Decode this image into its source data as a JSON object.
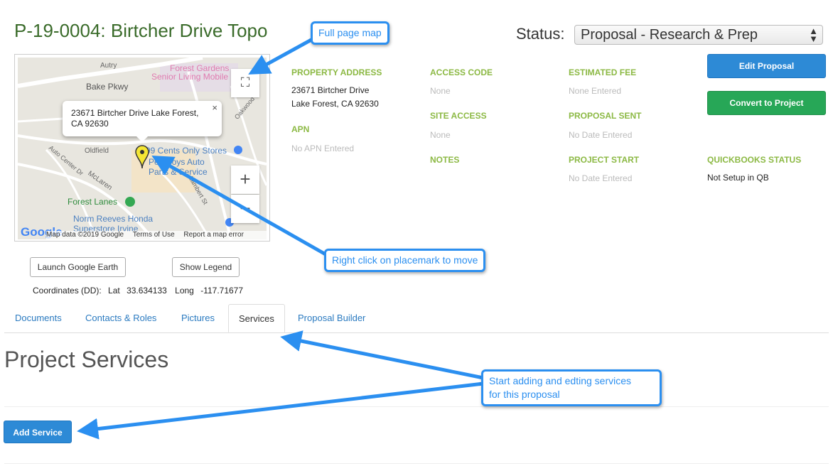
{
  "page": {
    "title": "P-19-0004: Birtcher Drive Topo",
    "status_label": "Status:",
    "status_value": "Proposal - Research & Prep"
  },
  "map": {
    "popup_line1": "23671 Birtcher Drive Lake Forest,",
    "popup_line2": "CA 92630",
    "close_glyph": "×",
    "zoom_in": "+",
    "zoom_out": "−",
    "labels": {
      "autry": "Autry",
      "bake_pkwy": "Bake Pkwy",
      "forest_gardens_1": "Forest Gardens",
      "forest_gardens_2": "Senior Living Mobile",
      "oldfield": "Oldfield",
      "auto_center": "Auto Center Dr",
      "mclaren": "McLaren",
      "cents_store": "99 Cents Only Stores",
      "pep_boys_1": "Pep Boys Auto",
      "pep_boys_2": "Parts & Service",
      "lambert": "Lambert St",
      "forest_lanes": "Forest Lanes",
      "norm_reeves_1": "Norm Reeves Honda",
      "norm_reeves_2": "Superstore Irvine",
      "oakwood": "Oakwood",
      "google": "Google"
    },
    "footer": {
      "data": "Map data ©2019 Google",
      "terms": "Terms of Use",
      "report": "Report a map error"
    }
  },
  "buttons": {
    "launch_earth": "Launch Google Earth",
    "show_legend": "Show Legend",
    "edit_proposal": "Edit Proposal",
    "convert_project": "Convert to Project",
    "add_service": "Add Service"
  },
  "coords": {
    "label": "Coordinates (DD):",
    "lat_label": "Lat",
    "lat": "33.634133",
    "long_label": "Long",
    "long": "-117.71677"
  },
  "details": {
    "property_address_label": "PROPERTY ADDRESS",
    "property_address_1": "23671 Birtcher Drive",
    "property_address_2": "Lake Forest, CA 92630",
    "apn_label": "APN",
    "apn_value": "No APN Entered",
    "access_code_label": "ACCESS CODE",
    "access_code_value": "None",
    "site_access_label": "SITE ACCESS",
    "site_access_value": "None",
    "notes_label": "NOTES",
    "estimated_fee_label": "ESTIMATED FEE",
    "estimated_fee_value": "None Entered",
    "proposal_sent_label": "PROPOSAL SENT",
    "proposal_sent_value": "No Date Entered",
    "project_start_label": "PROJECT START",
    "project_start_value": "No Date Entered",
    "quickbooks_label": "QUICKBOOKS STATUS",
    "quickbooks_value": "Not Setup in QB"
  },
  "tabs": [
    {
      "label": "Documents"
    },
    {
      "label": "Contacts & Roles"
    },
    {
      "label": "Pictures"
    },
    {
      "label": "Services"
    },
    {
      "label": "Proposal Builder"
    }
  ],
  "section": {
    "heading": "Project Services"
  },
  "callouts": {
    "full_map": "Full page map",
    "right_click": "Right click on placemark to move",
    "services_1": "Start adding and edting services",
    "services_2": "for this proposal"
  },
  "colors": {
    "title_green": "#3a6b2a",
    "label_green": "#8cb944",
    "primary_blue": "#2d8ad6",
    "success_green": "#27a757",
    "callout_blue": "#2b8ff0"
  }
}
